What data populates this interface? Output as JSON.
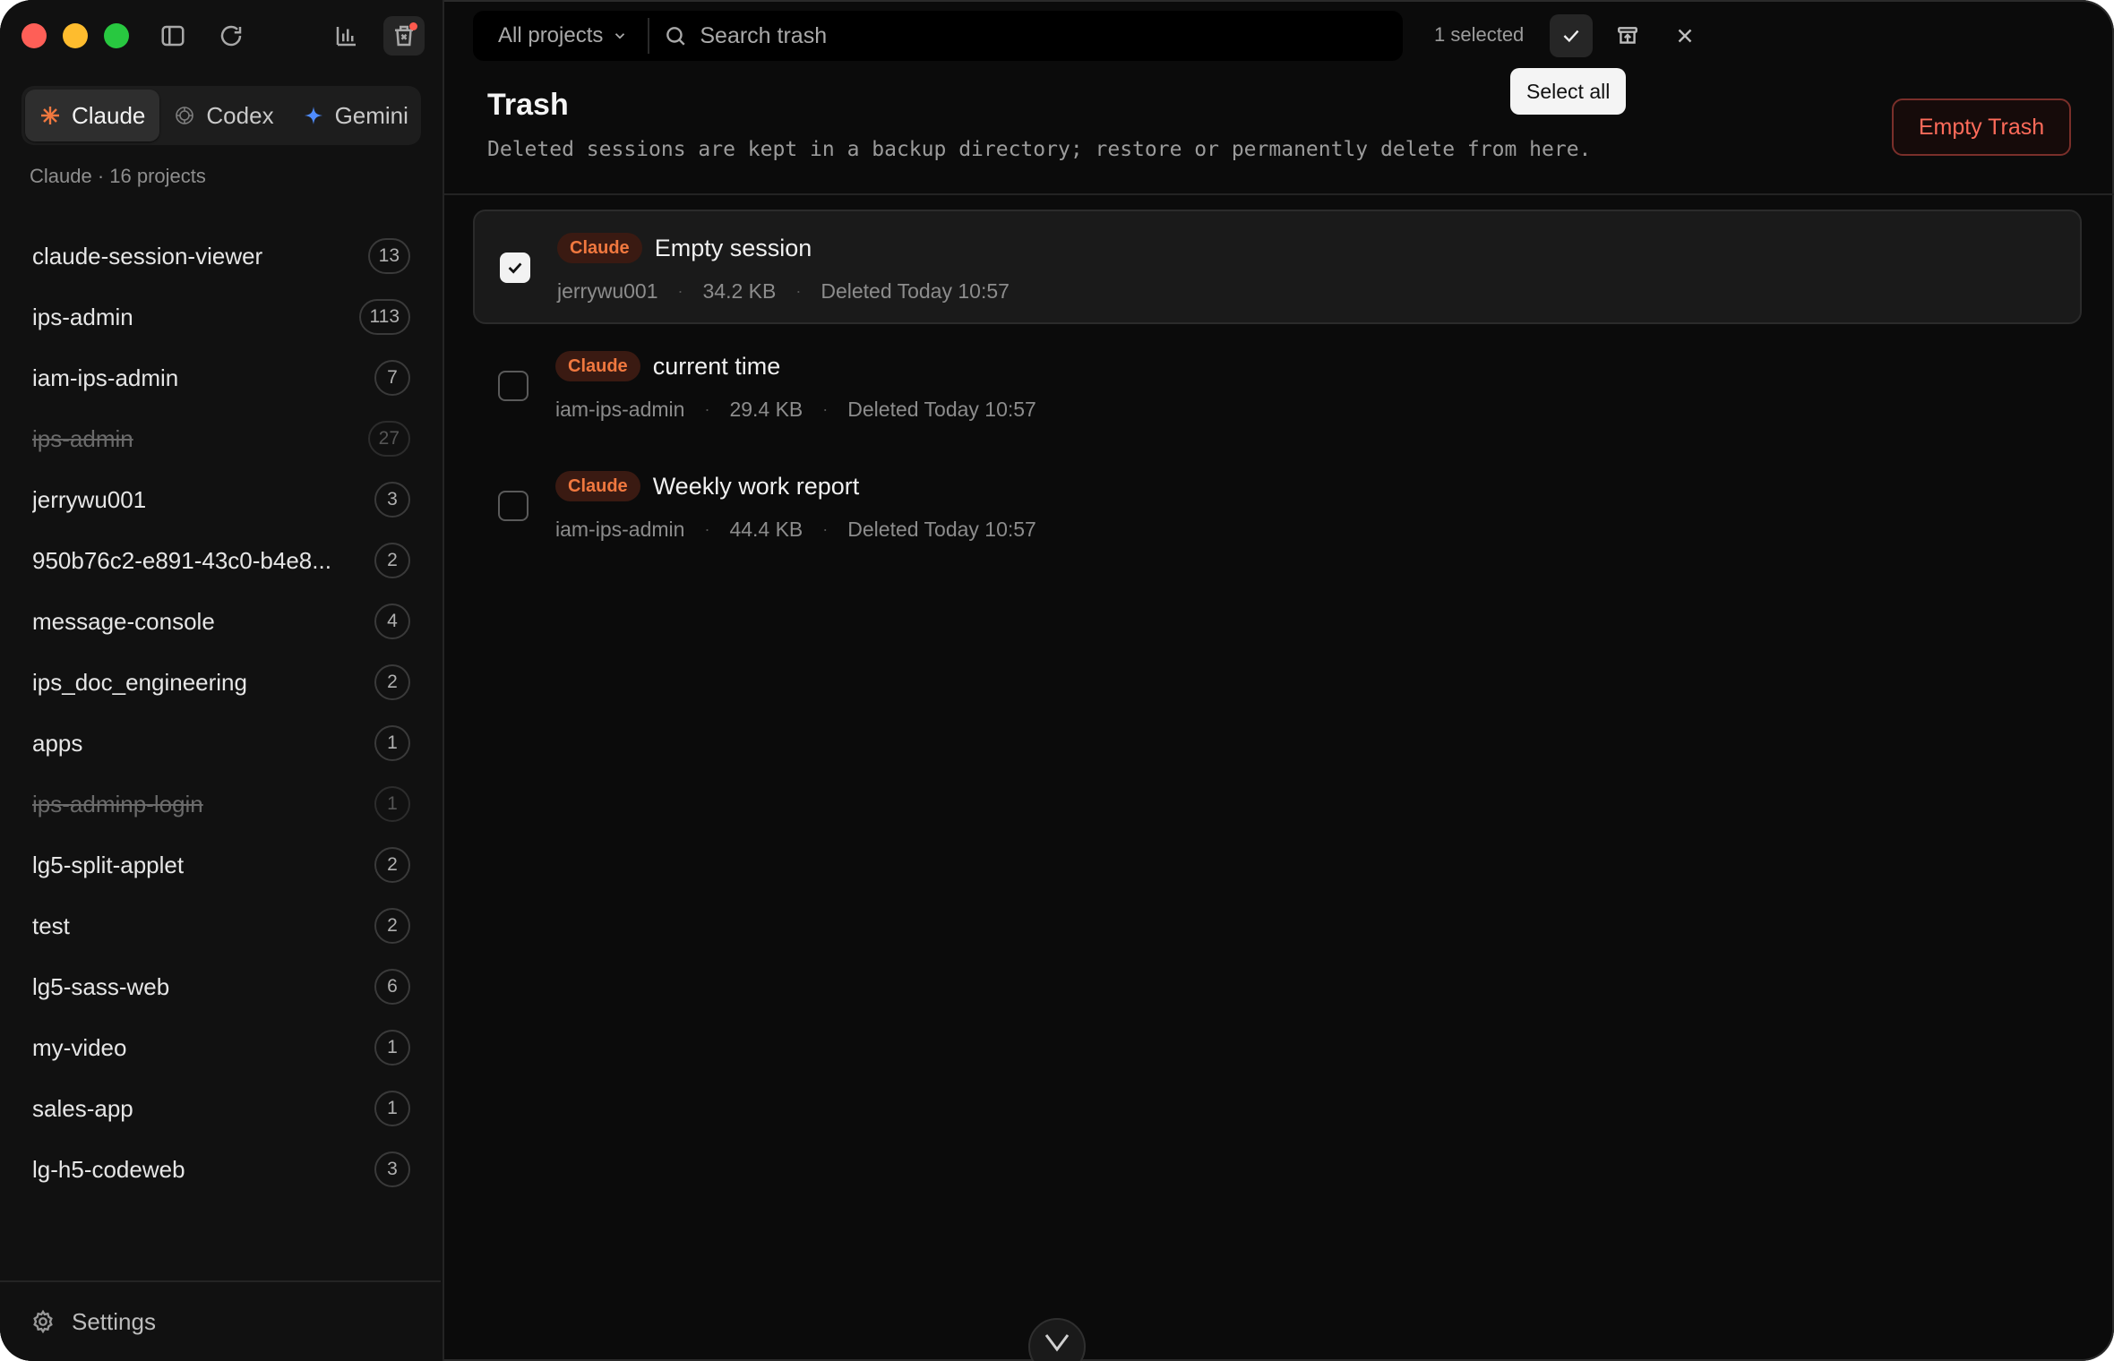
{
  "sidebar": {
    "providers": [
      {
        "label": "Claude",
        "icon": "claude-asterisk-icon",
        "color": "#f0783f",
        "active": true
      },
      {
        "label": "Codex",
        "icon": "openai-knot-icon",
        "color": "#8a8a8a",
        "active": false
      },
      {
        "label": "Gemini",
        "icon": "gemini-sparkle-icon",
        "color": "#4f8cff",
        "active": false
      }
    ],
    "caption": "Claude · 16 projects",
    "projects": [
      {
        "name": "claude-session-viewer",
        "count": "13",
        "struck": false
      },
      {
        "name": "ips-admin",
        "count": "113",
        "struck": false
      },
      {
        "name": "iam-ips-admin",
        "count": "7",
        "struck": false
      },
      {
        "name": "ips-admin",
        "count": "27",
        "struck": true
      },
      {
        "name": "jerrywu001",
        "count": "3",
        "struck": false
      },
      {
        "name": "950b76c2-e891-43c0-b4e8...",
        "count": "2",
        "struck": false
      },
      {
        "name": "message-console",
        "count": "4",
        "struck": false
      },
      {
        "name": "ips_doc_engineering",
        "count": "2",
        "struck": false
      },
      {
        "name": "apps",
        "count": "1",
        "struck": false
      },
      {
        "name": "ips-adminp-login",
        "count": "1",
        "struck": true
      },
      {
        "name": "lg5-split-applet",
        "count": "2",
        "struck": false
      },
      {
        "name": "test",
        "count": "2",
        "struck": false
      },
      {
        "name": "lg5-sass-web",
        "count": "6",
        "struck": false
      },
      {
        "name": "my-video",
        "count": "1",
        "struck": false
      },
      {
        "name": "sales-app",
        "count": "1",
        "struck": false
      },
      {
        "name": "lg-h5-codeweb",
        "count": "3",
        "struck": false
      }
    ],
    "settings_label": "Settings"
  },
  "toolbar": {
    "filter_label": "All projects",
    "search_placeholder": "Search trash",
    "selected_text": "1 selected",
    "tooltip": "Select all"
  },
  "main": {
    "title": "Trash",
    "subtitle": "Deleted sessions are kept in a backup directory; restore or permanently delete from here.",
    "empty_trash_label": "Empty Trash",
    "sessions": [
      {
        "badge": "Claude",
        "title": "Empty session",
        "project": "jerrywu001",
        "size": "34.2 KB",
        "deleted": "Deleted Today 10:57",
        "checked": true
      },
      {
        "badge": "Claude",
        "title": "current time",
        "project": "iam-ips-admin",
        "size": "29.4 KB",
        "deleted": "Deleted Today 10:57",
        "checked": false
      },
      {
        "badge": "Claude",
        "title": "Weekly work report",
        "project": "iam-ips-admin",
        "size": "44.4 KB",
        "deleted": "Deleted Today 10:57",
        "checked": false
      }
    ],
    "meta_separator": "·"
  },
  "colors": {
    "accent_danger": "#ff6b5a",
    "claude_badge": "#f0783f",
    "background": "#0b0b0b"
  }
}
